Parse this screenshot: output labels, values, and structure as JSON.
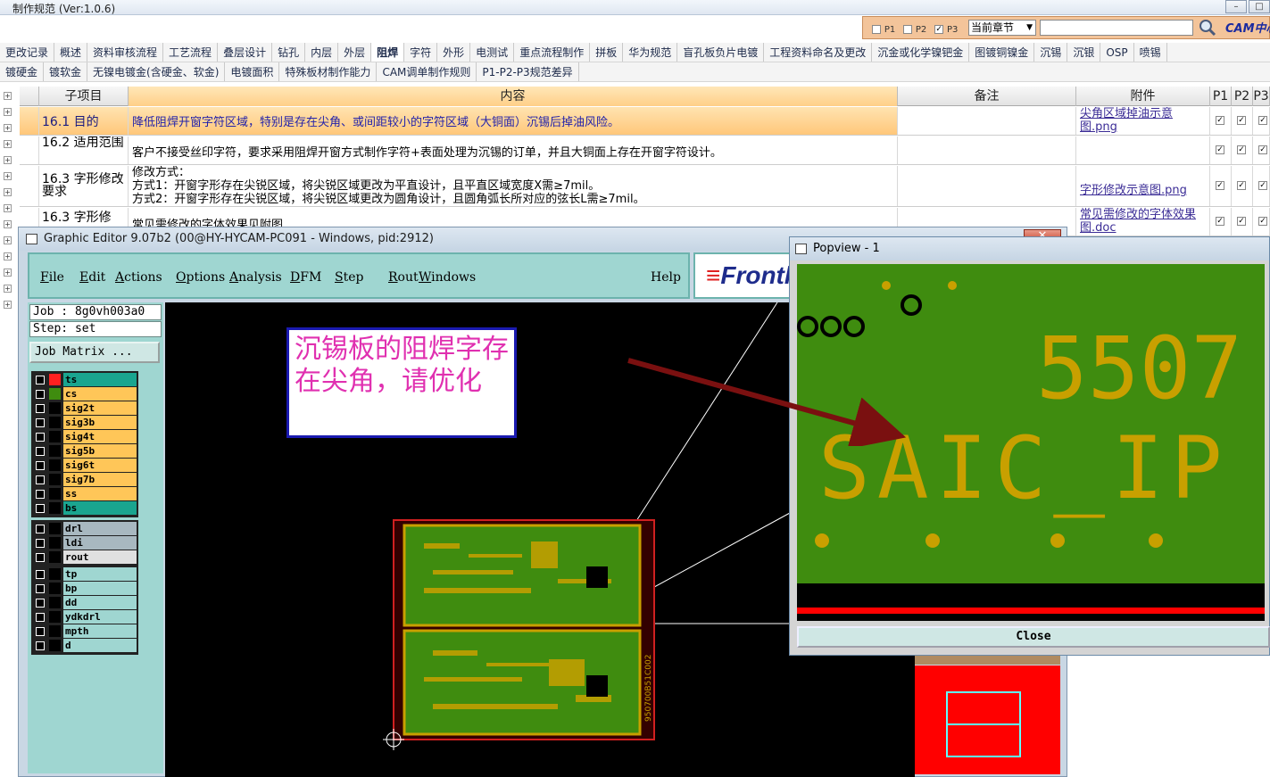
{
  "window": {
    "title": "制作规范 (Ver:1.0.6)"
  },
  "search": {
    "p1": "P1",
    "p2": "P2",
    "p3": "P3",
    "scope": "当前章节",
    "logo": "CAM中心"
  },
  "tabs_row1": [
    "更改记录",
    "概述",
    "资料审核流程",
    "工艺流程",
    "叠层设计",
    "钻孔",
    "内层",
    "外层",
    "阻焊",
    "字符",
    "外形",
    "电测试",
    "重点流程制作",
    "拼板",
    "华为规范",
    "盲孔板负片电镀",
    "工程资料命名及更改",
    "沉金或化学镍钯金",
    "图镀铜镍金",
    "沉锡",
    "沉银",
    "OSP",
    "喷锡"
  ],
  "tabs_row2": [
    "镀硬金",
    "镀软金",
    "无镍电镀金(含硬金、软金)",
    "电镀面积",
    "特殊板材制作能力",
    "CAM调单制作规则",
    "P1-P2-P3规范差异"
  ],
  "active_tab": "阻焊",
  "table": {
    "headers": {
      "item": "子项目",
      "content": "内容",
      "remark": "备注",
      "attach": "附件",
      "p1": "P1",
      "p2": "P2",
      "p3": "P3"
    },
    "rows": [
      {
        "item": "16.1 目的",
        "content": "降低阻焊开窗字符区域，特别是存在尖角、或间距较小的字符区域（大铜面）沉锡后掉油风险。",
        "attach": "尖角区域掉油示意图.png"
      },
      {
        "item": "16.2 适用范围",
        "content": "客户不接受丝印字符，要求采用阻焊开窗方式制作字符+表面处理为沉锡的订单，并且大铜面上存在开窗字符设计。",
        "attach": ""
      },
      {
        "item": "16.3 字形修改要求",
        "content1": "修改方式：",
        "content2": "方式1：开窗字形存在尖锐区域，将尖锐区域更改为平直设计，且平直区域宽度X需≥7mil。",
        "content3": "方式2：开窗字形存在尖锐区域，将尖锐区域更改为圆角设计，且圆角弧长所对应的弦长L需≥7mil。",
        "attach": "字形修改示意图.png"
      },
      {
        "item": "16.3 字形修",
        "content": "常见需修改的字体效果见附图",
        "attach": "常见需修改的字体效果图.doc"
      }
    ]
  },
  "graphic_editor": {
    "title": "Graphic Editor 9.07b2 (00@HY-HYCAM-PC091 - Windows, pid:2912)",
    "menu": [
      "File",
      "Edit",
      "Actions",
      "Options",
      "Analysis",
      "DFM",
      "Step",
      "Rout",
      "Windows"
    ],
    "help": "Help",
    "logo": "Frontl",
    "job": "Job : 8g0vh003a0",
    "step": "Step: set",
    "job_matrix": "Job Matrix ...",
    "layers_group1": [
      "ts",
      "cs",
      "sig2t",
      "sig3b",
      "sig4t",
      "sig5b",
      "sig6t",
      "sig7b",
      "ss",
      "bs"
    ],
    "layers_group2": [
      "drl",
      "ldi",
      "rout"
    ],
    "layers_group3": [
      "tp",
      "bp",
      "dd",
      "ydkdrl",
      "mpth",
      "d"
    ],
    "annotation": "沉锡板的阻焊字存在尖角，请优化",
    "board_label": "950700B51C002"
  },
  "popview": {
    "title": "Popview - 1",
    "text_top": "5507",
    "text_bottom": "SAIC_IP",
    "close": "Close"
  },
  "colors": {
    "pcb_green": "#3f8c0f",
    "pcb_text": "#c8a000",
    "annotation_text": "#e030b0",
    "arrow": "#7a1010",
    "minimap": "#ff0000"
  }
}
